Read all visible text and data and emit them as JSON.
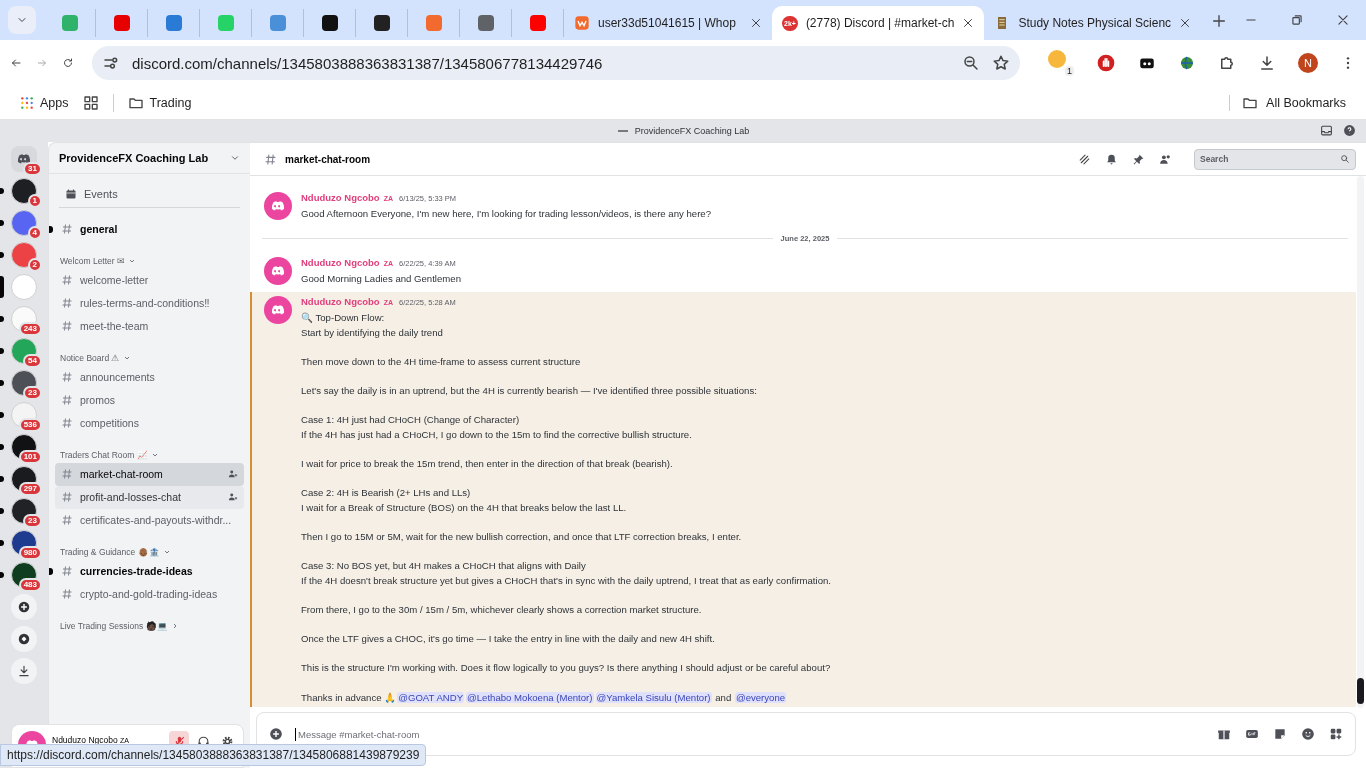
{
  "browser": {
    "pinned_tabs": [
      {
        "color": "#2fb36b"
      },
      {
        "color": "#e60000"
      },
      {
        "color": "#2a7bd5"
      },
      {
        "color": "#25d366"
      },
      {
        "color": "#4a90d9"
      },
      {
        "color": "#111111"
      },
      {
        "color": "#222222"
      },
      {
        "color": "#f26a2e"
      },
      {
        "color": "#5f6368"
      },
      {
        "color": "#ff0000"
      }
    ],
    "tabs": [
      {
        "title": "user33d51041615 | Whop",
        "selected": false
      },
      {
        "title": "(2778) Discord | #market-ch",
        "selected": true,
        "badge": "2k+"
      },
      {
        "title": "Study Notes Physical Scienc",
        "selected": false
      }
    ],
    "address": "discord.com/channels/1345803888363831387/1345806778134429746",
    "extension_badge": "1",
    "profile_initial": "N",
    "bookmarks": [
      "Apps",
      "Trading"
    ],
    "all_bookmarks": "All Bookmarks"
  },
  "discord": {
    "window_title": "ProvidenceFX Coaching Lab",
    "servers": [
      {
        "kind": "home",
        "badge": "31",
        "unread": false,
        "selected": false
      },
      {
        "kind": "server",
        "color": "#1e1f22",
        "badge": "1",
        "unread": true,
        "selected": false
      },
      {
        "kind": "server",
        "color": "#5865f2",
        "badge": "4",
        "unread": true,
        "selected": false
      },
      {
        "kind": "server",
        "color": "#ed4245",
        "badge": "2",
        "unread": true,
        "selected": false
      },
      {
        "kind": "server",
        "color": "#ffffff",
        "unread": false,
        "selected": true
      },
      {
        "kind": "server",
        "color": "#fafafa",
        "badge": "243",
        "unread": true,
        "selected": false
      },
      {
        "kind": "server",
        "color": "#23a55a",
        "badge": "54",
        "unread": true,
        "selected": false
      },
      {
        "kind": "server",
        "color": "#4e5058",
        "badge": "23",
        "unread": true,
        "selected": false
      },
      {
        "kind": "server",
        "color": "#f4f4f4",
        "badge": "536",
        "unread": true,
        "selected": false
      },
      {
        "kind": "server",
        "color": "#111214",
        "badge": "101",
        "unread": true,
        "selected": false
      },
      {
        "kind": "server",
        "color": "#1a1b1e",
        "badge": "297",
        "unread": true,
        "selected": false
      },
      {
        "kind": "server",
        "color": "#202225",
        "badge": "23",
        "unread": true,
        "selected": false
      },
      {
        "kind": "server",
        "color": "#1d3b8f",
        "badge": "980",
        "unread": true,
        "selected": false
      },
      {
        "kind": "server",
        "color": "#0f3d1f",
        "badge": "483",
        "unread": true,
        "selected": false
      }
    ],
    "guild_name": "ProvidenceFX Coaching Lab",
    "sidebar": [
      {
        "kind": "events",
        "label": "Events"
      },
      {
        "kind": "channel",
        "label": "general",
        "unread": true,
        "selected": false,
        "hovered": false
      },
      {
        "kind": "category",
        "label": "Welcom Letter ✉",
        "expanded": true,
        "children": [
          {
            "kind": "channel",
            "label": "welcome-letter",
            "unread": false,
            "selected": false,
            "hovered": false
          },
          {
            "kind": "channel",
            "label": "rules-terms-and-conditions‼",
            "unread": false,
            "selected": false,
            "hovered": false
          },
          {
            "kind": "channel",
            "label": "meet-the-team",
            "unread": false,
            "selected": false,
            "hovered": false
          }
        ]
      },
      {
        "kind": "category",
        "label": "Notice Board ⚠",
        "expanded": true,
        "children": [
          {
            "kind": "channel",
            "label": "announcements",
            "unread": false,
            "selected": false,
            "hovered": false
          },
          {
            "kind": "channel",
            "label": "promos",
            "unread": false,
            "selected": false,
            "hovered": false
          },
          {
            "kind": "channel",
            "label": "competitions",
            "unread": false,
            "selected": false,
            "hovered": false
          }
        ]
      },
      {
        "kind": "category",
        "label": "Traders Chat Room 📈",
        "expanded": true,
        "children": [
          {
            "kind": "channel",
            "label": "market-chat-room",
            "unread": false,
            "selected": true,
            "hovered": false,
            "invite": true
          },
          {
            "kind": "channel",
            "label": "profit-and-losses-chat",
            "unread": false,
            "selected": false,
            "hovered": true,
            "invite": true
          },
          {
            "kind": "channel",
            "label": "certificates-and-payouts-withdr...",
            "unread": false,
            "selected": false,
            "hovered": false
          }
        ]
      },
      {
        "kind": "category",
        "label": "Trading & Guidance 👴🏾🏦",
        "expanded": true,
        "children": [
          {
            "kind": "channel",
            "label": "currencies-trade-ideas",
            "unread": true,
            "selected": false,
            "hovered": false
          },
          {
            "kind": "channel",
            "label": "crypto-and-gold-trading-ideas",
            "unread": false,
            "selected": false,
            "hovered": false
          }
        ]
      },
      {
        "kind": "category",
        "label": "Live Trading Sessions 🧑🏿💻",
        "expanded": false
      }
    ],
    "user_panel": {
      "name": "Nduduzo Ngcobo",
      "tag": "ZA",
      "muted": true
    },
    "channel_header": {
      "name": "market-chat-room",
      "search_placeholder": "Search"
    },
    "messages": [
      {
        "kind": "message",
        "author": "Nduduzo Ngcobo",
        "tag": "ZA",
        "time": "6/13/25, 5:33 PM",
        "highlighted": false,
        "paragraphs": [
          [
            "Good Afternoon Everyone, I'm new here, I'm looking for trading lesson/videos, is there any here?"
          ]
        ]
      },
      {
        "kind": "divider",
        "label": "June 22, 2025"
      },
      {
        "kind": "message",
        "author": "Nduduzo Ngcobo",
        "tag": "ZA",
        "time": "6/22/25, 4:39 AM",
        "highlighted": false,
        "paragraphs": [
          [
            "Good Morning Ladies and Gentlemen"
          ]
        ]
      },
      {
        "kind": "message",
        "author": "Nduduzo Ngcobo",
        "tag": "ZA",
        "time": "6/22/25, 5:28 AM",
        "highlighted": true,
        "paragraphs": [
          [
            "🔍 Top-Down Flow:",
            "Start by identifying the daily trend"
          ],
          [
            "Then move down to the 4H time-frame to assess current structure"
          ],
          [
            "Let's say the daily is in an uptrend, but the 4H is currently bearish — I've identified three possible situations:"
          ],
          [
            "Case 1: 4H just had  CHoCH (Change of Character)",
            "If the 4H has just had a CHoCH, I go down to the 15m to find the corrective bullish structure."
          ],
          [
            "I wait for price to break the 15m trend, then enter in the direction of that break (bearish)."
          ],
          [
            "Case 2: 4H is Bearish (2+ LHs and LLs)",
            "I wait for a Break of Structure (BOS) on the 4H that breaks below the last LL."
          ],
          [
            "Then I go to 15M or 5M, wait for the new bullish correction, and once that LTF correction breaks, I enter."
          ],
          [
            "Case 3: No BOS yet, but 4H makes a CHoCH that aligns with Daily",
            "If the 4H doesn't break structure yet but gives a CHoCH that's in sync with the daily uptrend, I treat that as early confirmation."
          ],
          [
            "From there, I go to the 30m / 15m / 5m, whichever clearly shows a correction market structure."
          ],
          [
            "Once the LTF gives a CHOC, it's go time — I take the entry in line with the daily and new 4H shift."
          ],
          [
            "This is the structure I'm working with. Does it flow logically to you guys? Is there anything I should adjust or be careful about?"
          ],
          [
            [
              {
                "kind": "text",
                "text": "Thanks in advance 🙏"
              },
              {
                "kind": "mention",
                "text": "@GOAT ANDY"
              },
              {
                "kind": "mention",
                "text": "@Lethabo Mokoena (Mentor)"
              },
              {
                "kind": "mention",
                "text": "@Yamkela Sisulu (Mentor)"
              },
              {
                "kind": "text",
                "text": " and "
              },
              {
                "kind": "mention",
                "text": "@everyone"
              }
            ]
          ]
        ]
      }
    ],
    "composer": {
      "placeholder": "Message #market-chat-room"
    }
  },
  "status_url": "https://discord.com/channels/1345803888363831387/1345806881439879239"
}
